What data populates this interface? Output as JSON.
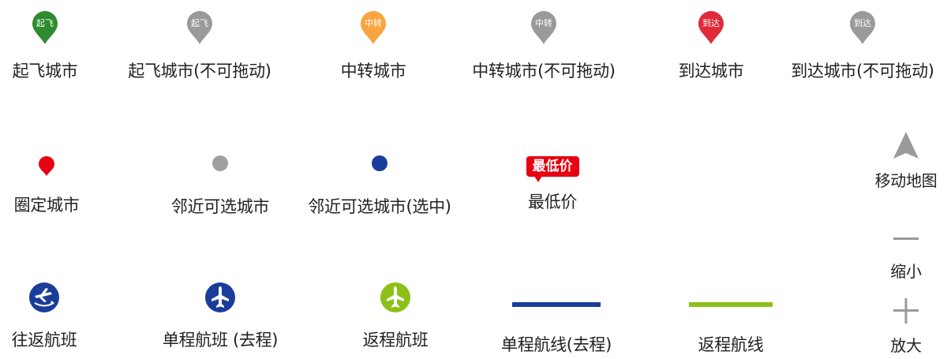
{
  "row1": [
    {
      "pin_text": "起飞",
      "label": "起飞城市",
      "color": "#2e8b2e"
    },
    {
      "pin_text": "起飞",
      "label": "起飞城市(不可拖动)",
      "color": "#9a9a9a"
    },
    {
      "pin_text": "中转",
      "label": "中转城市",
      "color": "#f7a541"
    },
    {
      "pin_text": "中转",
      "label": "中转城市(不可拖动)",
      "color": "#9a9a9a"
    },
    {
      "pin_text": "到达",
      "label": "到达城市",
      "color": "#e02a3a"
    },
    {
      "pin_text": "到达",
      "label": "到达城市(不可拖动)",
      "color": "#9a9a9a"
    }
  ],
  "row2": [
    {
      "label": "圈定城市",
      "color": "#e60012",
      "icon": "small-pin-icon"
    },
    {
      "label": "邻近可选城市",
      "color": "#a0a0a0",
      "icon": "dot-icon"
    },
    {
      "label": "邻近可选城市(选中)",
      "color": "#1a3d99",
      "icon": "dot-icon"
    },
    {
      "label": "最低价",
      "badge_text": "最低价",
      "color": "#e60012",
      "icon": "price-badge"
    }
  ],
  "row3": [
    {
      "label": "往返航班",
      "color": "#1a3d99",
      "icon": "round-trip-plane-icon"
    },
    {
      "label": "单程航班 (去程)",
      "color": "#1a3d99",
      "icon": "plane-icon"
    },
    {
      "label": "返程航班",
      "color": "#8cc018",
      "icon": "plane-icon"
    },
    {
      "label": "单程航线(去程)",
      "color": "#1a3d99",
      "icon": "route-line"
    },
    {
      "label": "返程航线",
      "color": "#8cc018",
      "icon": "route-line"
    }
  ],
  "controls": {
    "move": {
      "label": "移动地图",
      "icon": "arrow-up-icon"
    },
    "zoom_out": {
      "label": "缩小",
      "icon": "minus-icon"
    },
    "zoom_in": {
      "label": "放大",
      "icon": "plus-icon"
    }
  }
}
